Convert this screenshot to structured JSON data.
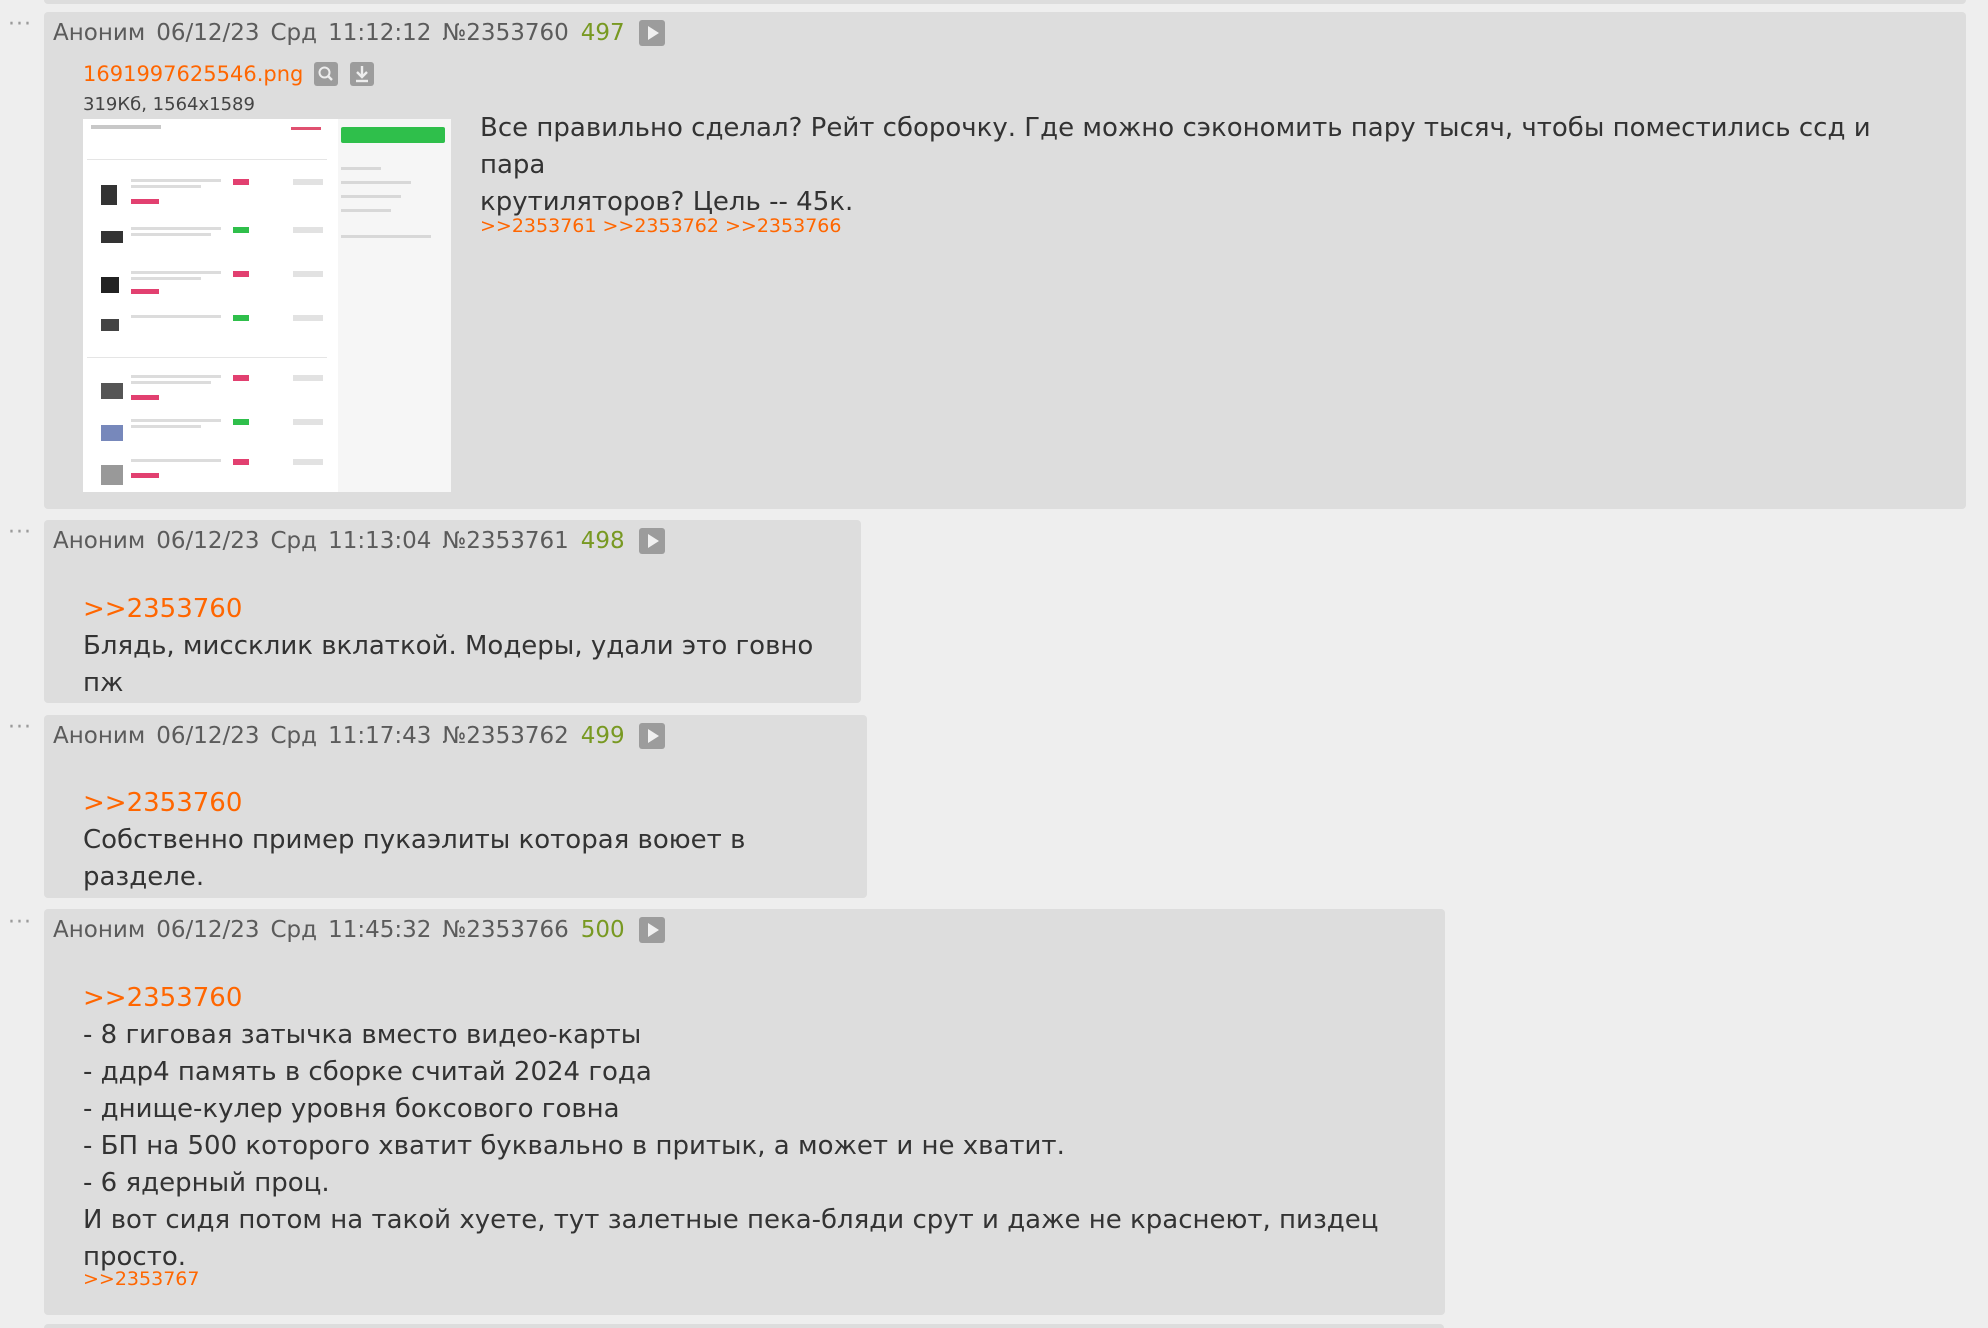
{
  "posts": [
    {
      "name": "Аноним",
      "date": "06/12/23",
      "day": "Срд",
      "time": "11:12:12",
      "num": "№2353760",
      "count": "497",
      "file": {
        "name": "1691997625546.png",
        "meta": "319Кб, 1564x1589"
      },
      "lines": [
        "Все правильно сделал? Рейт сборочку. Где можно сэкономить пару тысяч, чтобы поместились ссд и пара",
        "крутиляторов? Цель -- 45к."
      ],
      "replies": ">>2353761 >>2353762 >>2353766"
    },
    {
      "name": "Аноним",
      "date": "06/12/23",
      "day": "Срд",
      "time": "11:13:04",
      "num": "№2353761",
      "count": "498",
      "quote": ">>2353760",
      "lines": [
        "Блядь, миссклик вклаткой. Модеры, удали это говно пж"
      ]
    },
    {
      "name": "Аноним",
      "date": "06/12/23",
      "day": "Срд",
      "time": "11:17:43",
      "num": "№2353762",
      "count": "499",
      "quote": ">>2353760",
      "lines": [
        "Собственно пример пукаэлиты которая воюет в разделе."
      ]
    },
    {
      "name": "Аноним",
      "date": "06/12/23",
      "day": "Срд",
      "time": "11:45:32",
      "num": "№2353766",
      "count": "500",
      "quote": ">>2353760",
      "lines": [
        "- 8 гиговая затычка вместо видео-карты",
        "- ддр4 память в сборке считай 2024 года",
        "- днище-кулер уровня боксового говна",
        "- БП на 500 которого хватит буквально в притык, а может и не хватит.",
        "- 6 ядерный проц.",
        "И вот сидя потом на такой хуете, тут залетные пека-бляди срут и даже не краснеют, пиздец просто."
      ],
      "replies": ">>2353767"
    }
  ],
  "icons": {
    "menu": "ellipsis-icon",
    "play": "play-icon",
    "search": "search-icon",
    "download": "download-icon"
  },
  "colors": {
    "background": "#eeeeee",
    "post": "#dddddd",
    "link": "#ff6600",
    "post_count": "#789922",
    "text": "#333333"
  }
}
